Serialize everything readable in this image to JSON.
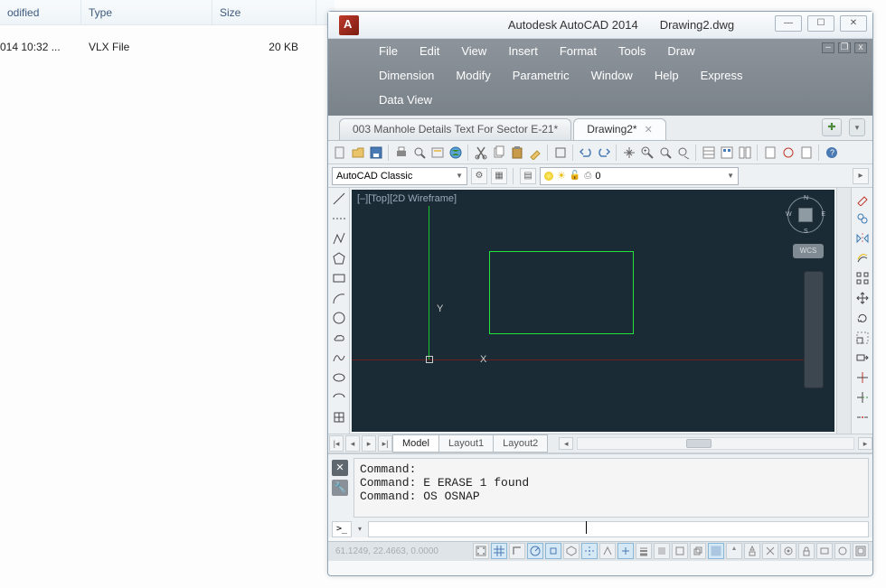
{
  "explorer": {
    "columns": {
      "modified": "odified",
      "type": "Type",
      "size": "Size"
    },
    "row": {
      "modified": "014 10:32 ...",
      "type": "VLX File",
      "size": "20 KB"
    }
  },
  "titlebar": {
    "app": "Autodesk AutoCAD 2014",
    "file": "Drawing2.dwg"
  },
  "menu": {
    "row1": [
      "File",
      "Edit",
      "View",
      "Insert",
      "Format",
      "Tools",
      "Draw"
    ],
    "row2": [
      "Dimension",
      "Modify",
      "Parametric",
      "Window",
      "Help",
      "Express"
    ],
    "row3": [
      "Data View"
    ]
  },
  "doc_tabs": [
    {
      "label": "003 Manhole Details Text For Sector E-21*",
      "active": false,
      "closable": false
    },
    {
      "label": "Drawing2*",
      "active": true,
      "closable": true
    }
  ],
  "workspace": {
    "combo": "AutoCAD Classic"
  },
  "layer": {
    "current": "0"
  },
  "viewport": {
    "label": "[–][Top][2D Wireframe]",
    "wcs": "WCS",
    "y": "Y",
    "x": "X"
  },
  "layout_tabs": {
    "model": "Model",
    "l1": "Layout1",
    "l2": "Layout2"
  },
  "command": {
    "history": "Command:\nCommand: E ERASE 1 found\nCommand: OS OSNAP",
    "prompt_icon": ">_"
  },
  "status": {
    "coords": "61.1249, 22.4663, 0.0000"
  }
}
